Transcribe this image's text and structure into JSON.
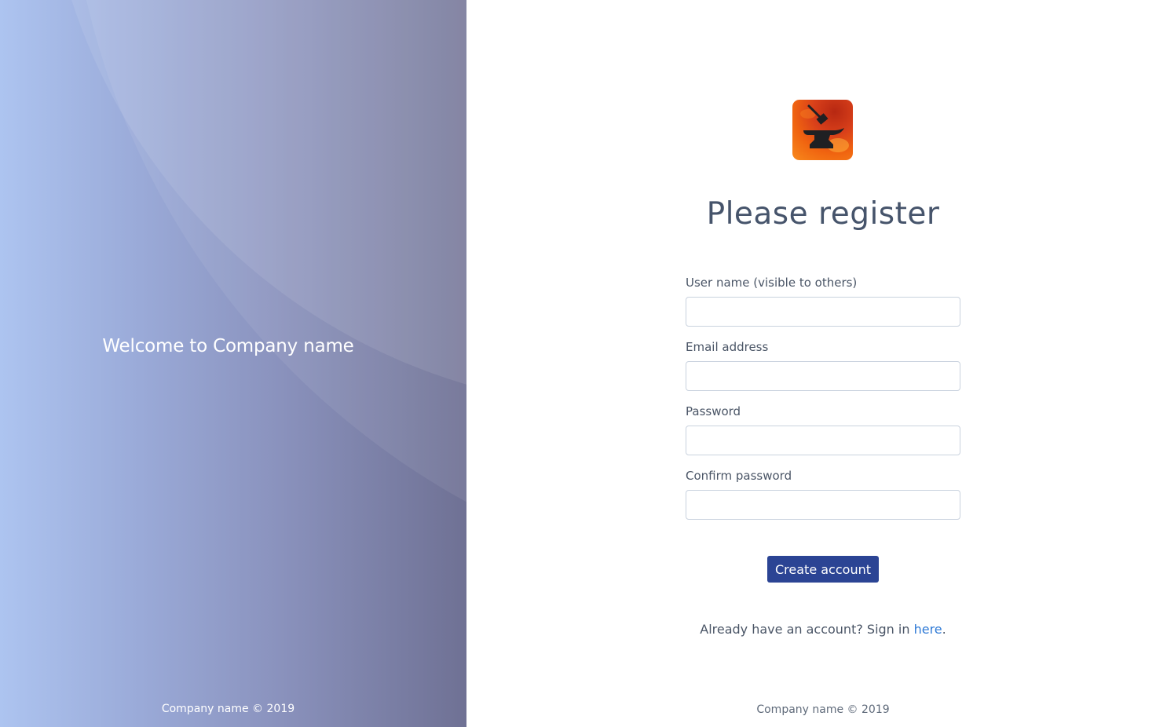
{
  "left_panel": {
    "welcome_text": "Welcome to Company name",
    "footer_text": "Company name © 2019"
  },
  "register": {
    "logo_icon": "anvil-hammer-icon",
    "title": "Please register",
    "fields": [
      {
        "label": "User name (visible to others)",
        "value": "",
        "type": "text"
      },
      {
        "label": "Email address",
        "value": "",
        "type": "email"
      },
      {
        "label": "Password",
        "value": "",
        "type": "password"
      },
      {
        "label": "Confirm password",
        "value": "",
        "type": "password"
      }
    ],
    "submit_label": "Create account",
    "signin_prefix": "Already have an account? Sign in ",
    "signin_link_text": "here",
    "signin_suffix": ".",
    "footer_text": "Company name © 2019"
  },
  "colors": {
    "primary_button": "#2b4494",
    "link": "#2f7ad6",
    "title_text": "#46546b"
  }
}
